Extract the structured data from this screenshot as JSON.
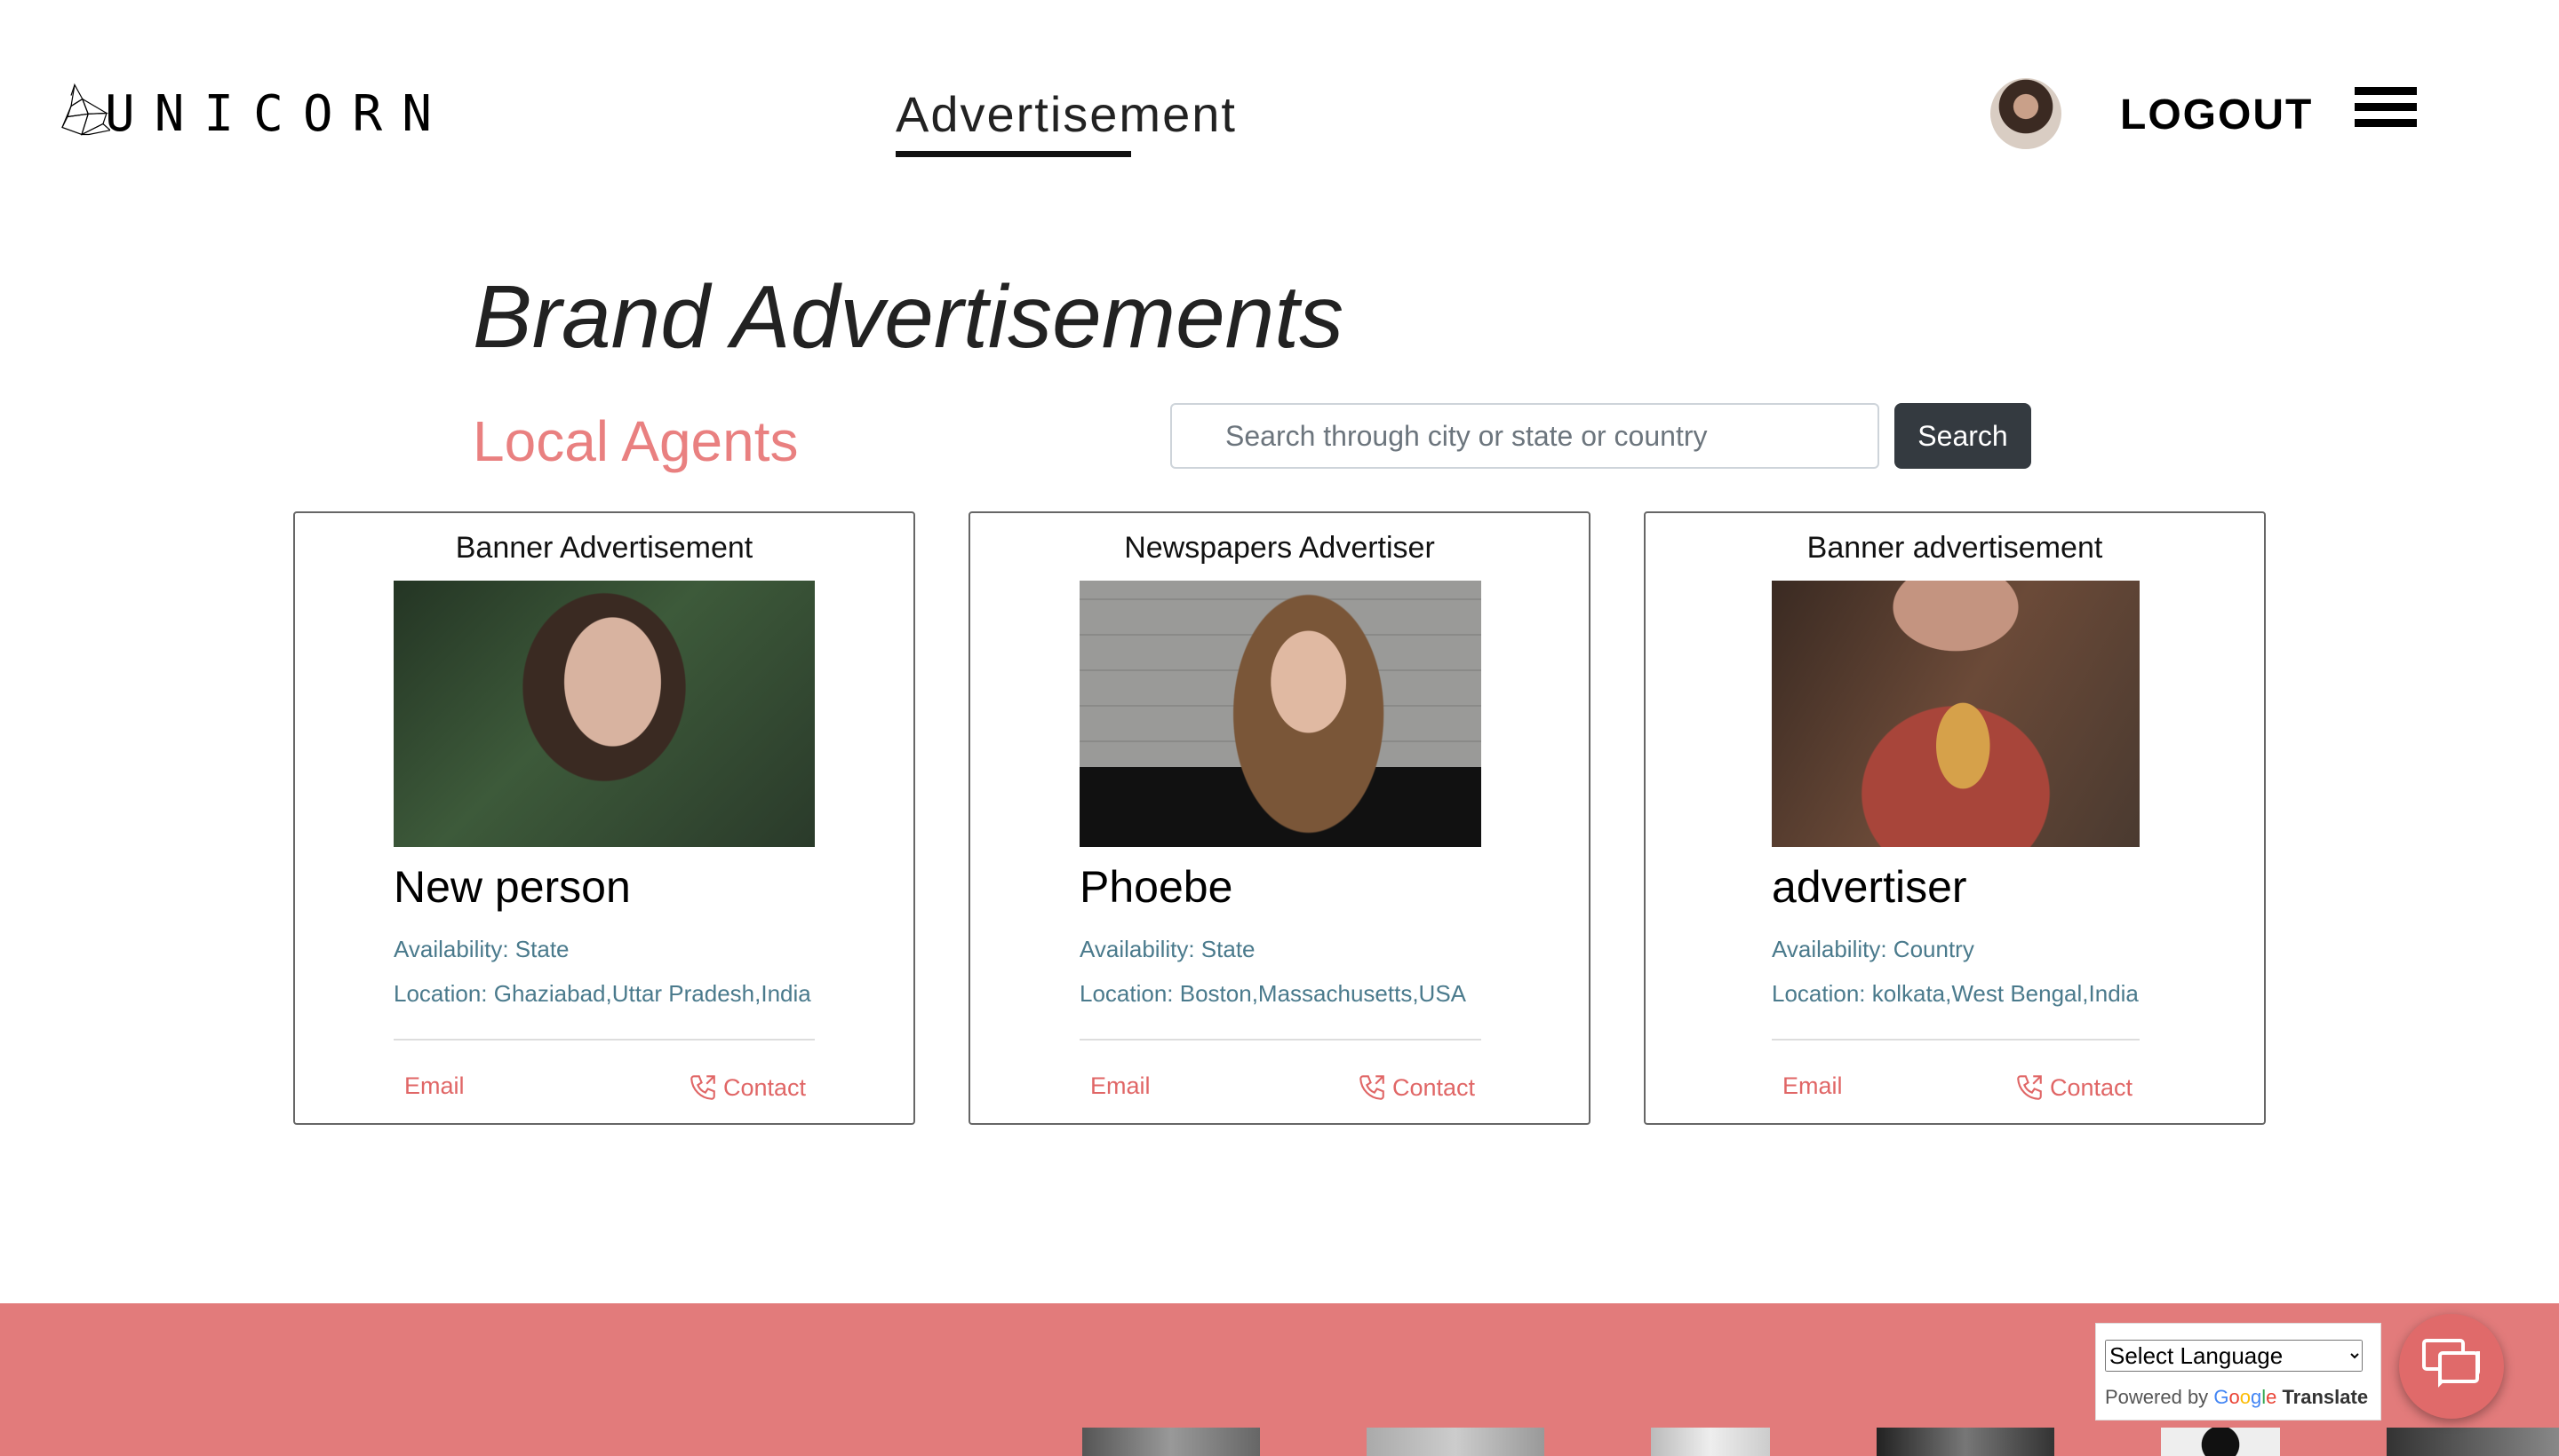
{
  "header": {
    "logo_text": "UNICORN",
    "nav_link": "Advertisement",
    "logout_label": "LOGOUT"
  },
  "page": {
    "title": "Brand Advertisements",
    "section_title": "Local Agents"
  },
  "search": {
    "placeholder": "Search through city or state or country",
    "button_label": "Search"
  },
  "cards": [
    {
      "type": "Banner Advertisement",
      "name": "New person",
      "availability": "Availability: State",
      "location": "Location: Ghaziabad,Uttar Pradesh,India",
      "email_label": "Email",
      "contact_label": "Contact"
    },
    {
      "type": "Newspapers Advertiser",
      "name": "Phoebe",
      "availability": "Availability: State",
      "location": "Location: Boston,Massachusetts,USA",
      "email_label": "Email",
      "contact_label": "Contact"
    },
    {
      "type": "Banner advertisement",
      "name": "advertiser",
      "availability": "Availability: Country",
      "location": "Location: kolkata,West Bengal,India",
      "email_label": "Email",
      "contact_label": "Contact"
    }
  ],
  "footer": {
    "language_select": "Select Language",
    "powered_by": "Powered by",
    "google": [
      "G",
      "o",
      "o",
      "g",
      "l",
      "e"
    ],
    "translate": "Translate"
  },
  "colors": {
    "accent": "#e98080",
    "footer_bg": "#e27b7b",
    "link": "#e06666",
    "meta_text": "#4a7a8c",
    "button_dark": "#343a40"
  },
  "icons": {
    "logo": "unicorn-head-icon",
    "menu": "hamburger-icon",
    "contact": "phone-icon",
    "chat": "chat-bubbles-icon"
  }
}
